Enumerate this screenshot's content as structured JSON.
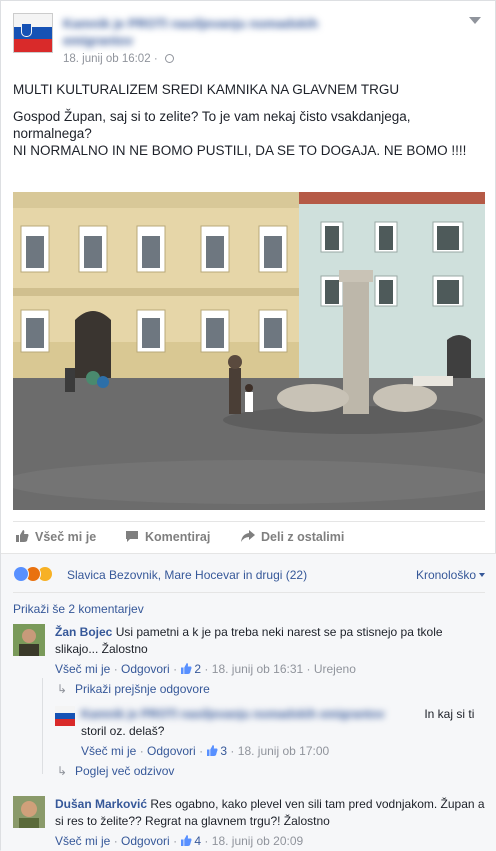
{
  "post": {
    "page_name": "Kamnik je PROTI nasiljevanju nomadskih emigrantov",
    "timestamp": "18. junij ob 16:02",
    "text_line1": "MULTI KULTURALIZEM SREDI KAMNIKA NA GLAVNEM TRGU",
    "text_line2": "Gospod Župan, saj si to zelite? To je vam nekaj čisto vsakdanjega, normalnega?",
    "text_line3": "NI NORMALNO IN NE BOMO PUSTILI, DA SE TO DOGAJA. NE BOMO !!!!"
  },
  "actions": {
    "like": "Všeč mi je",
    "comment": "Komentiraj",
    "share": "Deli z ostalimi"
  },
  "reactions": {
    "names": "Slavica Bezovnik, Mare Hocevar in drugi (22)",
    "sort": "Kronološko"
  },
  "comments_section": {
    "show_more": "Prikaži še 2 komentarjev",
    "c1": {
      "author": "Žan Bojec",
      "text": "Usi pametni a k je pa treba neki narest se pa stisnejo pa tkole slikajo... Žalostno",
      "like": "Všeč mi je",
      "reply": "Odgovori",
      "likes": "2",
      "time": "18. junij ob 16:31",
      "edited": "Urejeno"
    },
    "prev_replies": "Prikaži prejšnje odgovore",
    "r1": {
      "author": "Kamnik je PROTI nasiljevanju nomadskih emigrantov",
      "text": "In kaj si ti storil oz. delaš?",
      "like": "Všeč mi je",
      "reply": "Odgovori",
      "likes": "3",
      "time": "18. junij ob 17:00"
    },
    "more_replies": "Poglej več odzivov",
    "c2": {
      "author": "Dušan Marković",
      "text": "Res ogabno, kako plevel ven sili tam pred vodnjakom. Župan a si res to želite?? Regrat na glavnem trgu?! Žalostno",
      "like": "Všeč mi je",
      "reply": "Odgovori",
      "likes": "4",
      "time": "18. junij ob 20:09"
    }
  },
  "colors": {
    "link": "#365899",
    "muted": "#90949c",
    "like_blue": "#5890ff",
    "angry": "#e9710f",
    "sad": "#f7b125"
  }
}
